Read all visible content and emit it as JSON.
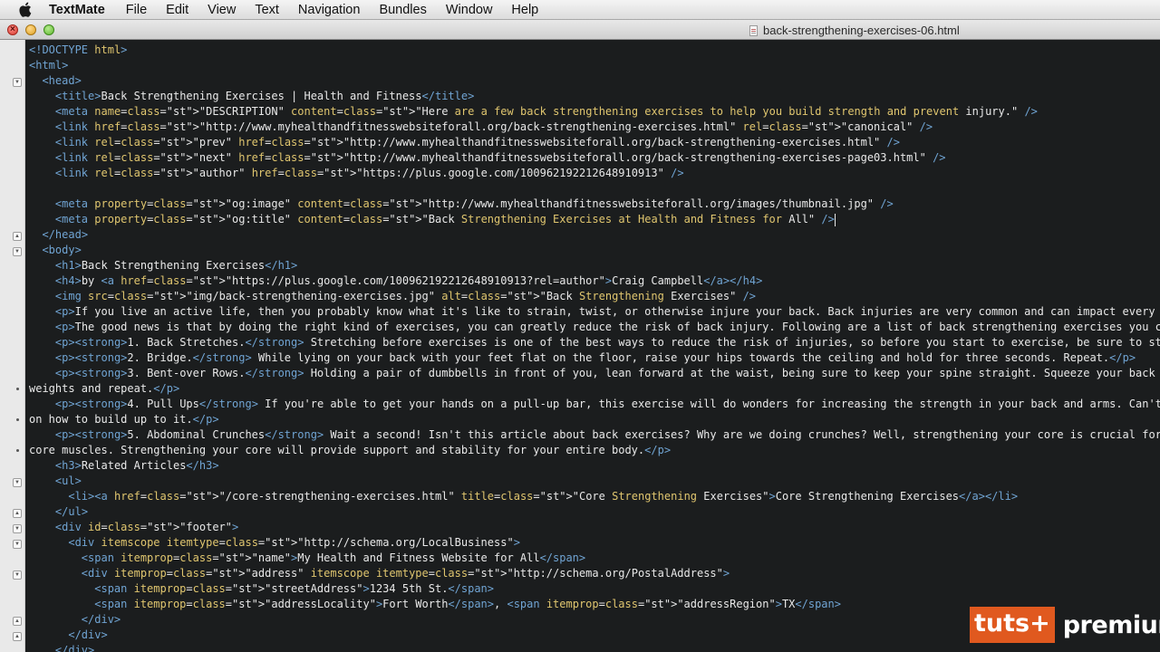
{
  "menubar": {
    "app_name": "TextMate",
    "items": [
      "File",
      "Edit",
      "View",
      "Text",
      "Navigation",
      "Bundles",
      "Window",
      "Help"
    ]
  },
  "window": {
    "title": "back-strengthening-exercises-06.html"
  },
  "editor": {
    "lines": [
      "<!DOCTYPE html>",
      "<html>",
      "  <head>",
      "    <title>Back Strengthening Exercises | Health and Fitness</title>",
      "    <meta name=\"DESCRIPTION\" content=\"Here are a few back strengthening exercises to help you build strength and prevent injury.\" />",
      "    <link href=\"http://www.myhealthandfitnesswebsiteforall.org/back-strengthening-exercises.html\" rel=\"canonical\" />",
      "    <link rel=\"prev\" href=\"http://www.myhealthandfitnesswebsiteforall.org/back-strengthening-exercises.html\" />",
      "    <link rel=\"next\" href=\"http://www.myhealthandfitnesswebsiteforall.org/back-strengthening-exercises-page03.html\" />",
      "    <link rel=\"author\" href=\"https://plus.google.com/100962192212648910913\" />",
      "",
      "    <meta property=\"og:image\" content=\"http://www.myhealthandfitnesswebsiteforall.org/images/thumbnail.jpg\" />",
      "    <meta property=\"og:title\" content=\"Back Strengthening Exercises at Health and Fitness for All\" />",
      "  </head>",
      "  <body>",
      "    <h1>Back Strengthening Exercises</h1>",
      "    <h4>by <a href=\"https://plus.google.com/100962192212648910913?rel=author\">Craig Campbell</a></h4>",
      "    <img src=\"img/back-strengthening-exercises.jpg\" alt=\"Back Strengthening Exercises\" />",
      "    <p>If you live an active life, then you probably know what it's like to strain, twist, or otherwise injure your back. Back injuries are very common and can impact every",
      "    <p>The good news is that by doing the right kind of exercises, you can greatly reduce the risk of back injury. Following are a list of back strengthening exercises you c",
      "    <p><strong>1. Back Stretches.</strong> Stretching before exercises is one of the best ways to reduce the risk of injuries, so before you start to exercise, be sure to st",
      "    <p><strong>2. Bridge.</strong> While lying on your back with your feet flat on the floor, raise your hips towards the ceiling and hold for three seconds. Repeat.</p>",
      "    <p><strong>3. Bent-over Rows.</strong> Holding a pair of dumbbells in front of you, lean forward at the waist, being sure to keep your spine straight. Squeeze your back m",
      "weights and repeat.</p>",
      "    <p><strong>4. Pull Ups</strong> If you're able to get your hands on a pull-up bar, this exercise will do wonders for increasing the strength in your back and arms. Can't",
      "on how to build up to it.</p>",
      "    <p><strong>5. Abdominal Crunches</strong> Wait a second! Isn't this article about back exercises? Why are we doing crunches? Well, strengthening your core is crucial for",
      "core muscles. Strengthening your core will provide support and stability for your entire body.</p>",
      "    <h3>Related Articles</h3>",
      "    <ul>",
      "      <li><a href=\"/core-strengthening-exercises.html\" title=\"Core Strengthening Exercises\">Core Strengthening Exercises</a></li>",
      "    </ul>",
      "    <div id=\"footer\">",
      "      <div itemscope itemtype=\"http://schema.org/LocalBusiness\">",
      "        <span itemprop=\"name\">My Health and Fitness Website for All</span>",
      "        <div itemprop=\"address\" itemscope itemtype=\"http://schema.org/PostalAddress\">",
      "          <span itemprop=\"streetAddress\">1234 5th St.</span>",
      "          <span itemprop=\"addressLocality\">Fort Worth</span>, <span itemprop=\"addressRegion\">TX</span>",
      "        </div>",
      "      </div>",
      "    </div>"
    ]
  },
  "watermark": {
    "box": "tuts+",
    "text": "premium"
  },
  "colors": {
    "tag": "#70a4d3",
    "attribute": "#e0c66f",
    "string": "#92c254",
    "text": "#e9e9e9",
    "background": "#1b1d1e"
  }
}
